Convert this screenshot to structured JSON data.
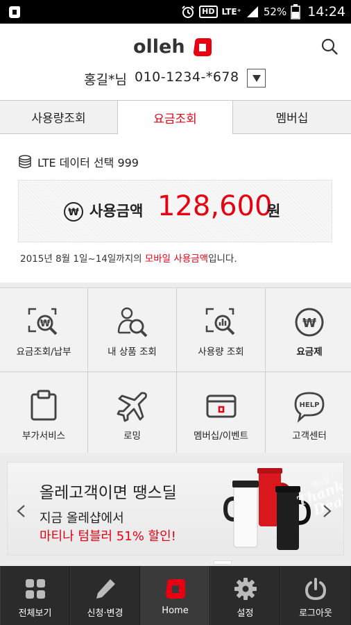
{
  "status_bar": {
    "lte": "LTE⁺",
    "battery": "52%",
    "time": "14:24",
    "hd": "HD"
  },
  "header": {
    "logo_text": "olleh",
    "user_name": "홍길*님",
    "phone": "010-1234-*678"
  },
  "tabs": [
    {
      "label": "사용량조회",
      "selected": false
    },
    {
      "label": "요금조회",
      "selected": true
    },
    {
      "label": "멤버십",
      "selected": false
    }
  ],
  "usage": {
    "plan": "LTE 데이터 선택 999",
    "amount_label": "사용금액",
    "amount_value": "128,600",
    "amount_unit": "원",
    "period_prefix": "2015년 8월 1일~14일까지의 ",
    "period_highlight": "모바일 사용금액",
    "period_suffix": "입니다."
  },
  "grid": [
    {
      "label": "요금조회/납부",
      "icon": "bill-search-icon"
    },
    {
      "label": "내 상품 조회",
      "icon": "product-search-icon"
    },
    {
      "label": "사용량 조회",
      "icon": "usage-search-icon"
    },
    {
      "label": "요금제",
      "icon": "won-circle-icon"
    },
    {
      "label": "부가서비스",
      "icon": "clipboard-icon"
    },
    {
      "label": "로밍",
      "icon": "airplane-icon"
    },
    {
      "label": "멤버십/이벤트",
      "icon": "card-icon"
    },
    {
      "label": "고객센터",
      "icon": "help-bubble-icon"
    }
  ],
  "banner": {
    "title": "올레고객이면 땡스딜",
    "line2": "지금 올레샵에서",
    "line3": "마티나 텀블러 51% 할인!",
    "badge": "Thanks Deal"
  },
  "bottom_nav": [
    {
      "label": "전체보기",
      "icon": "grid-icon"
    },
    {
      "label": "신청·변경",
      "icon": "pencil-icon"
    },
    {
      "label": "Home",
      "icon": "olleh-home-icon"
    },
    {
      "label": "설정",
      "icon": "gear-icon"
    },
    {
      "label": "로그아웃",
      "icon": "power-icon"
    }
  ],
  "colors": {
    "accent": "#e60012",
    "nav_bg": "#2b2b2b"
  }
}
